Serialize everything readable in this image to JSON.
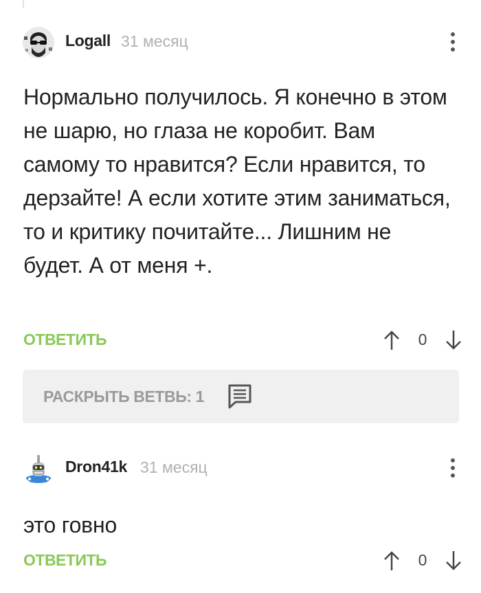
{
  "colors": {
    "reply_green": "#8ac858",
    "muted_gray": "#b0b0b0",
    "panel_bg": "#f0f0f0",
    "text_dark": "#222222"
  },
  "comments": [
    {
      "username": "Logall",
      "timestamp": "31 месяц",
      "avatar_icon": "bearded-man-sunglasses-avatar",
      "more_icon": "vertical-ellipsis-icon",
      "body": "Нормально получилось. Я конечно в этом не шарю, но глаза не коробит. Вам самому то нравится? Если нравится, то дерзайте! А если хотите этим заниматься, то и критику почитайте... Лишним не будет. А от меня +.",
      "reply_label": "ОТВЕТИТЬ",
      "vote_count": "0",
      "upvote_icon": "arrow-up-icon",
      "downvote_icon": "arrow-down-icon"
    },
    {
      "username": "Dron41k",
      "timestamp": "31 месяц",
      "avatar_icon": "bender-robot-avatar",
      "more_icon": "vertical-ellipsis-icon",
      "body": "это говно",
      "reply_label": "ОТВЕТИТЬ",
      "vote_count": "0",
      "upvote_icon": "arrow-up-icon",
      "downvote_icon": "arrow-down-icon"
    }
  ],
  "expand_thread": {
    "label": "РАСКРЫТЬ ВЕТВЬ: 1",
    "icon": "comment-bubble-icon"
  }
}
